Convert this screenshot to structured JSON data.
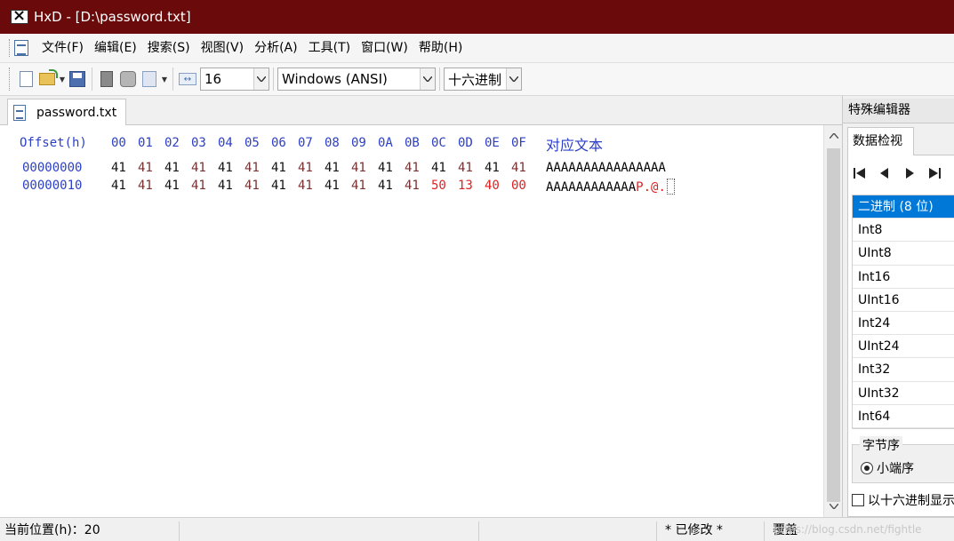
{
  "window": {
    "title": "HxD - [D:\\password.txt]"
  },
  "menu": [
    "文件(F)",
    "编辑(E)",
    "搜索(S)",
    "视图(V)",
    "分析(A)",
    "工具(T)",
    "窗口(W)",
    "帮助(H)"
  ],
  "toolbar": {
    "bytes_per_row": "16",
    "charset": "Windows (ANSI)",
    "offset_base": "十六进制"
  },
  "document_tab": "password.txt",
  "hex_view": {
    "offset_header": "Offset(h)",
    "column_headers": [
      "00",
      "01",
      "02",
      "03",
      "04",
      "05",
      "06",
      "07",
      "08",
      "09",
      "0A",
      "0B",
      "0C",
      "0D",
      "0E",
      "0F"
    ],
    "text_header": "对应文本",
    "rows": [
      {
        "offset": "00000000",
        "bytes": [
          "41",
          "41",
          "41",
          "41",
          "41",
          "41",
          "41",
          "41",
          "41",
          "41",
          "41",
          "41",
          "41",
          "41",
          "41",
          "41"
        ],
        "modified": [
          false,
          false,
          false,
          false,
          false,
          false,
          false,
          false,
          false,
          false,
          false,
          false,
          false,
          false,
          false,
          false
        ],
        "text_plain": "AAAAAAAAAAAAAAAA",
        "text_modified": ""
      },
      {
        "offset": "00000010",
        "bytes": [
          "41",
          "41",
          "41",
          "41",
          "41",
          "41",
          "41",
          "41",
          "41",
          "41",
          "41",
          "41",
          "50",
          "13",
          "40",
          "00"
        ],
        "modified": [
          false,
          false,
          false,
          false,
          false,
          false,
          false,
          false,
          false,
          false,
          false,
          false,
          true,
          true,
          true,
          true
        ],
        "text_plain": "AAAAAAAAAAAA",
        "text_modified": "P.@."
      }
    ]
  },
  "colors": {
    "titlebar": "#6b0a0a",
    "header_blue": "#2b3fc7",
    "modified_red": "#e02020",
    "byte_black": "#111111",
    "byte_alt": "#7a3030",
    "selection": "#0078d7"
  },
  "special_editor": {
    "header": "特殊编辑器",
    "tab": "数据检视",
    "nav_icons": [
      "first-icon",
      "prev-icon",
      "next-icon",
      "last-icon"
    ],
    "types": [
      "二进制 (8 位)",
      "Int8",
      "UInt8",
      "Int16",
      "UInt16",
      "Int24",
      "UInt24",
      "Int32",
      "UInt32",
      "Int64"
    ],
    "selected_type": "二进制 (8 位)",
    "byte_order": {
      "legend": "字节序",
      "option": "小端序"
    },
    "hex_checkbox": "以十六进制显示"
  },
  "status": {
    "position": "当前位置(h)：20",
    "modified": "* 已修改 *",
    "mode": "覆盖"
  },
  "watermark": "https://blog.csdn.net/fightle"
}
